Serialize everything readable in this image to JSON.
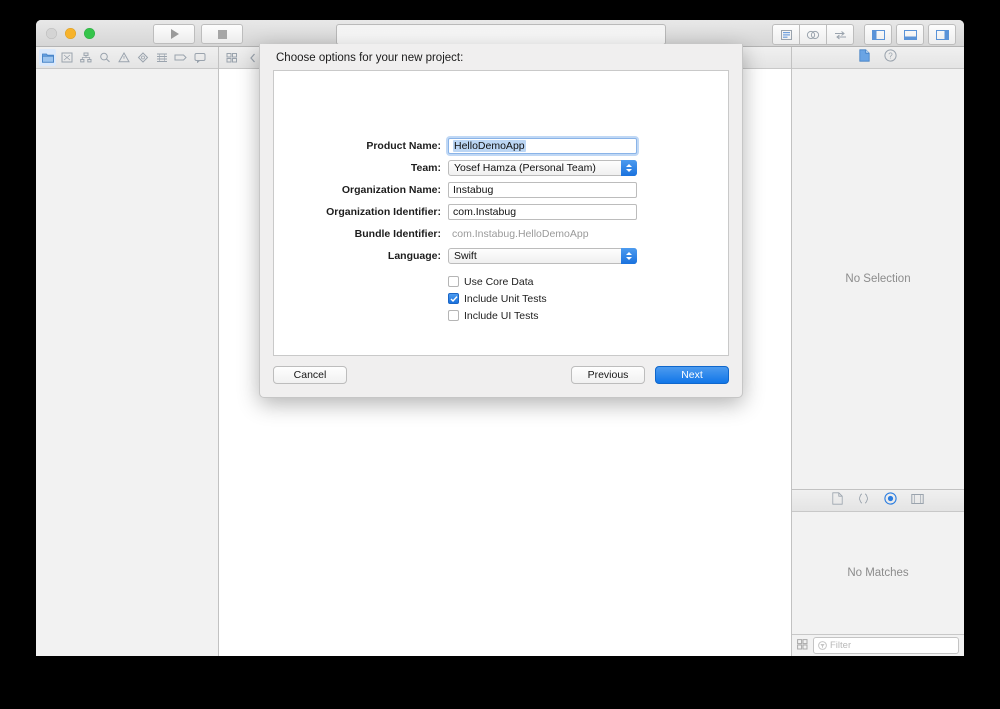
{
  "window": {
    "traffic_lights": [
      "close",
      "minimize",
      "zoom"
    ],
    "toolbar": {
      "run_label": "run-button",
      "stop_label": "stop-button",
      "activity_text": "",
      "editor_modes": [
        "standard-editor",
        "assistant-editor",
        "version-editor"
      ],
      "view_toggles": [
        "toggle-navigator",
        "toggle-debug-area",
        "toggle-utilities"
      ]
    }
  },
  "navigator": {
    "tabs": [
      {
        "name": "project-navigator",
        "active": true
      },
      {
        "name": "source-control-navigator",
        "active": false
      },
      {
        "name": "symbol-navigator",
        "active": false
      },
      {
        "name": "find-navigator",
        "active": false
      },
      {
        "name": "issue-navigator",
        "active": false
      },
      {
        "name": "test-navigator",
        "active": false
      },
      {
        "name": "debug-navigator",
        "active": false
      },
      {
        "name": "breakpoint-navigator",
        "active": false
      },
      {
        "name": "report-navigator",
        "active": false
      }
    ]
  },
  "utilities": {
    "inspector_tabs": [
      {
        "name": "file-inspector",
        "active": true
      },
      {
        "name": "quick-help-inspector",
        "active": false
      }
    ],
    "inspector_empty_text": "No Selection",
    "library_tabs": [
      {
        "name": "file-template-library",
        "active": false
      },
      {
        "name": "code-snippet-library",
        "active": false
      },
      {
        "name": "object-library",
        "active": true
      },
      {
        "name": "media-library",
        "active": false
      }
    ],
    "library_empty_text": "No Matches",
    "filter_placeholder": "Filter"
  },
  "sheet": {
    "title": "Choose options for your new project:",
    "fields": [
      {
        "label": "Product Name:",
        "value": "HelloDemoApp",
        "type": "text",
        "focused": true
      },
      {
        "label": "Team:",
        "value": "Yosef Hamza (Personal Team)",
        "type": "popup",
        "focused": false
      },
      {
        "label": "Organization Name:",
        "value": "Instabug",
        "type": "text",
        "focused": false
      },
      {
        "label": "Organization Identifier:",
        "value": "com.Instabug",
        "type": "text",
        "focused": false
      },
      {
        "label": "Bundle Identifier:",
        "value": "com.Instabug.HelloDemoApp",
        "type": "static",
        "focused": false
      },
      {
        "label": "Language:",
        "value": "Swift",
        "type": "popup",
        "focused": false
      }
    ],
    "checkboxes": [
      {
        "label": "Use Core Data",
        "checked": false
      },
      {
        "label": "Include Unit Tests",
        "checked": true
      },
      {
        "label": "Include UI Tests",
        "checked": false
      }
    ],
    "buttons": {
      "cancel": "Cancel",
      "previous": "Previous",
      "next": "Next"
    }
  },
  "colors": {
    "accent_blue": "#1a72de",
    "selection_blue": "#bcd6f4",
    "window_chrome": "#e8e8e8",
    "panel_gray": "#f2f2f2"
  }
}
